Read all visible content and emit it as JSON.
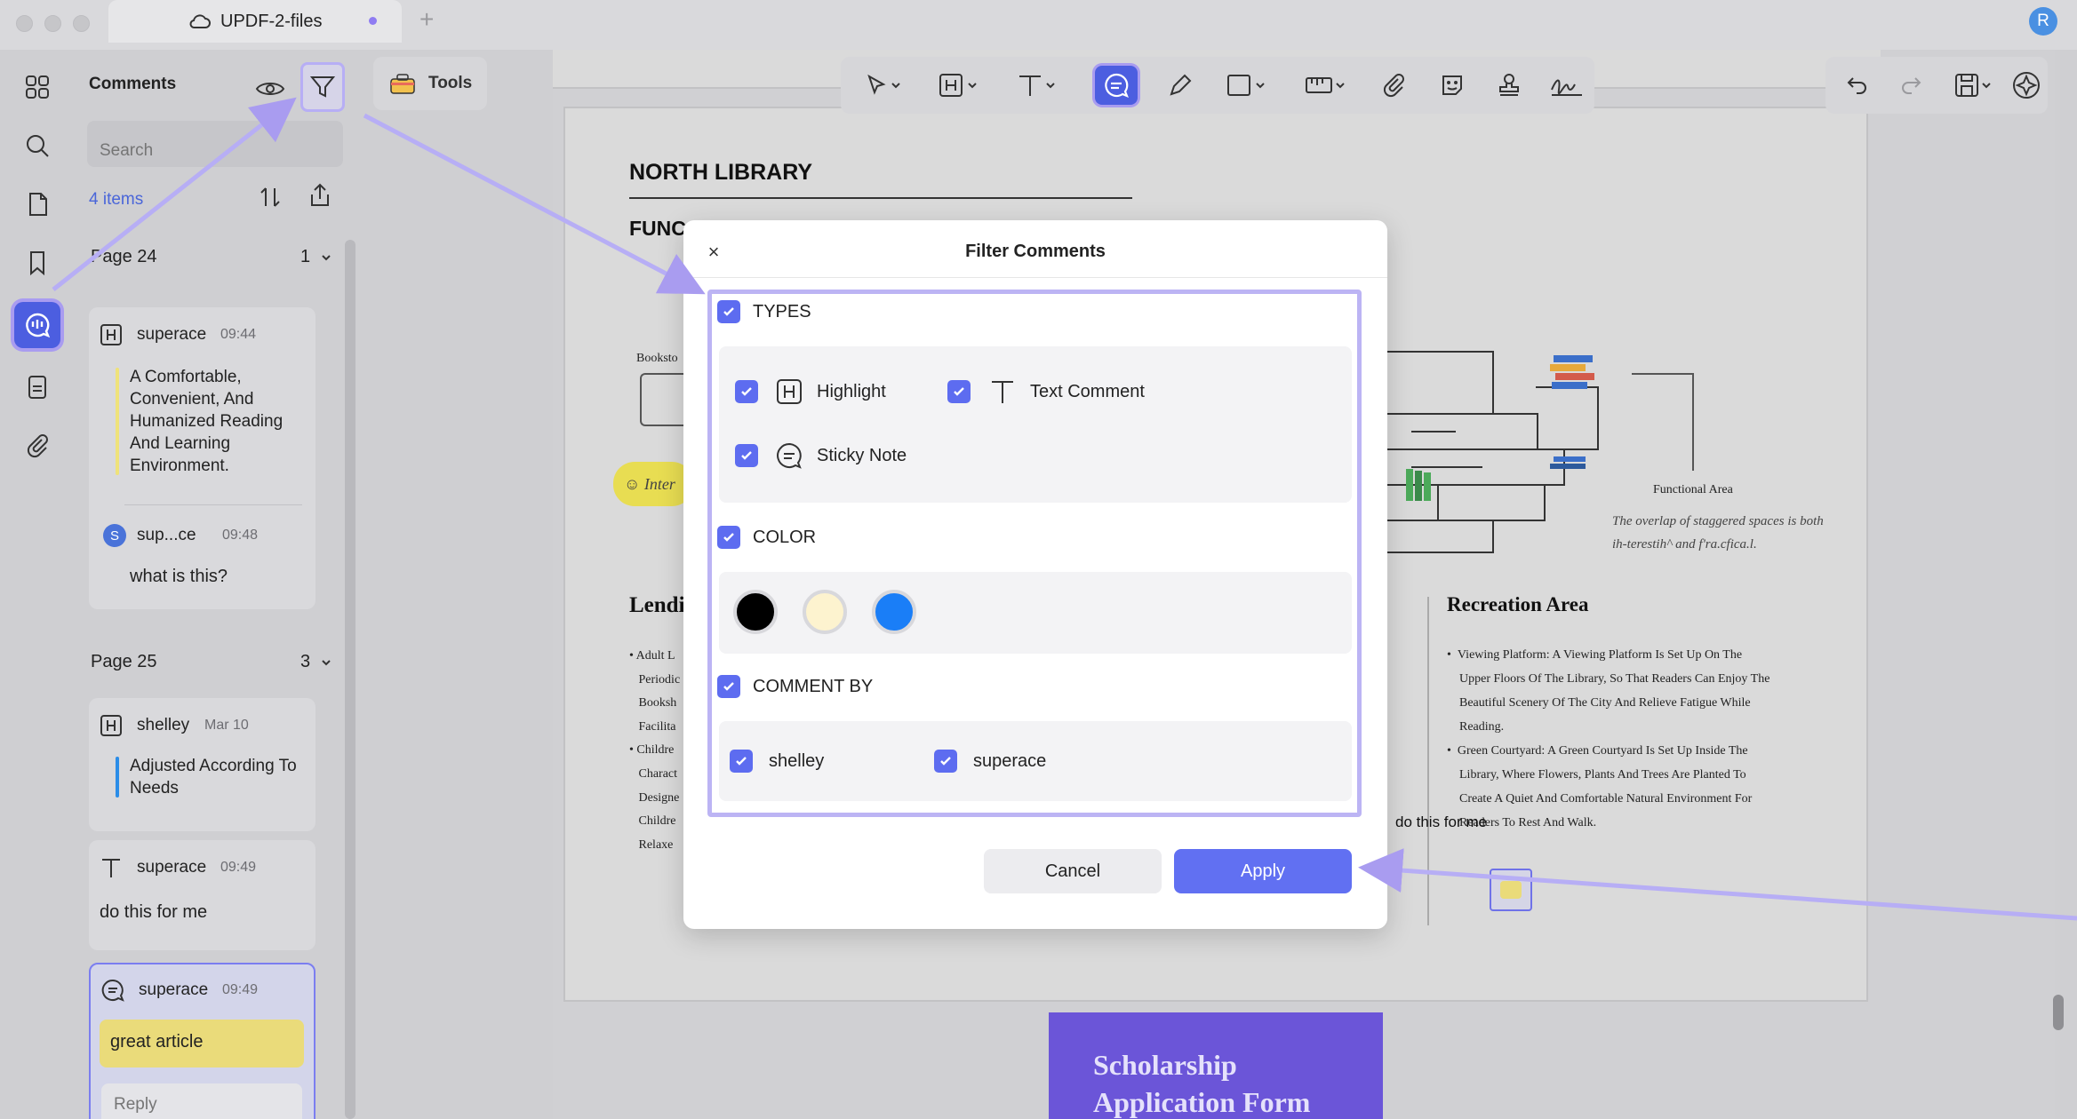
{
  "window": {
    "tab_title": "UPDF-2-files",
    "new_tab": "+",
    "user_initial": "R"
  },
  "panel": {
    "title": "Comments",
    "search_placeholder": "Search",
    "items_count": "4 items",
    "groups": [
      {
        "page": "Page 24",
        "count": "1",
        "comments": [
          {
            "type": "highlight",
            "author": "superace",
            "time": "09:44",
            "quote": "A Comfortable, Convenient, And Humanized Reading And Learning Environment.",
            "bar_color": "#efe27a",
            "reply": {
              "avatar": "S",
              "author": "sup...ce",
              "time": "09:48",
              "text": "what is this?"
            }
          }
        ]
      },
      {
        "page": "Page 25",
        "count": "3",
        "comments": [
          {
            "type": "highlight",
            "author": "shelley",
            "time": "Mar 10",
            "quote": "Adjusted According To Needs",
            "bar_color": "#2b8de8"
          },
          {
            "type": "text-comment",
            "author": "superace",
            "time": "09:49",
            "text": "do this for me"
          },
          {
            "type": "sticky-note",
            "author": "superace",
            "time": "09:49",
            "text": "great article",
            "reply_placeholder": "Reply"
          }
        ]
      }
    ]
  },
  "toolbar": {
    "tools_label": "Tools"
  },
  "document": {
    "title": "NORTH LIBRARY",
    "subtitle_fragment": "FUNC",
    "lending_fragment": "Lendi",
    "bookstore_fragment": "Booksto",
    "inter_fragment": "Inter",
    "left_list": [
      "Adult L",
      "Periodic",
      "Booksh",
      "Facilita",
      "Childre",
      "Charact",
      "Designe",
      "Childre",
      "Relaxe"
    ],
    "functional_area_label": "Functional Area",
    "functional_area_note": "The overlap of staggered spaces is both ih-terestih^ and f'ra.cfica.l.",
    "recreation_title": "Recreation Area",
    "recreation_items": [
      "Viewing Platform: A Viewing Platform Is Set Up On The Upper Floors Of The Library, So That Readers Can Enjoy The Beautiful Scenery Of The City And Relieve Fatigue While Reading.",
      "Green Courtyard: A Green Courtyard Is Set Up Inside The Library, Where Flowers, Plants And Trees Are Planted To Create A Quiet And Comfortable Natural Environment For Readers To Rest And Walk."
    ],
    "inline_comment": "do this for me",
    "next_page_title_line1": "Scholarship",
    "next_page_title_line2": "Application Form"
  },
  "modal": {
    "title": "Filter Comments",
    "close": "×",
    "types_label": "TYPES",
    "type_options": [
      "Highlight",
      "Text Comment",
      "Sticky Note"
    ],
    "color_label": "COLOR",
    "colors": [
      "#000000",
      "#fdf3cf",
      "#1a7ef7"
    ],
    "comment_by_label": "COMMENT BY",
    "authors": [
      "shelley",
      "superace"
    ],
    "cancel_label": "Cancel",
    "apply_label": "Apply"
  },
  "colors": {
    "accent": "#5d6cf0",
    "annotation": "#b7aef5"
  }
}
